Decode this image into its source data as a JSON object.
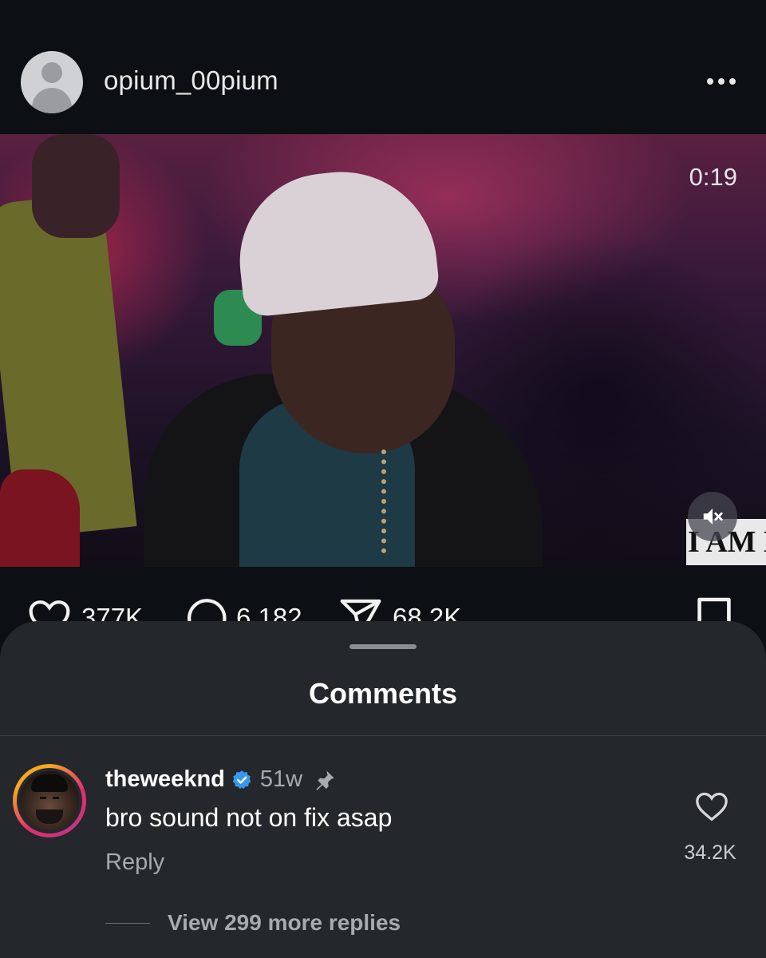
{
  "post": {
    "username": "opium_00pium",
    "video": {
      "time": "0:19",
      "watermark": "I AM M"
    },
    "actions": {
      "likes": "377K",
      "comments": "6,182",
      "shares": "68.2K"
    }
  },
  "comments_sheet": {
    "title": "Comments",
    "comment": {
      "username": "theweeknd",
      "time": "51w",
      "text": "bro sound not on fix asap",
      "reply_label": "Reply",
      "like_count": "34.2K",
      "view_replies": "View 299 more replies"
    }
  },
  "colors": {
    "background": "#0c0f13",
    "sheet": "#24272b",
    "verified": "#3897f0",
    "muted_text": "#a7abb0"
  },
  "icons": [
    "avatar-placeholder-icon",
    "more-icon",
    "mute-icon",
    "heart-icon",
    "comment-icon",
    "share-icon",
    "bookmark-icon",
    "verified-icon",
    "pin-icon"
  ]
}
